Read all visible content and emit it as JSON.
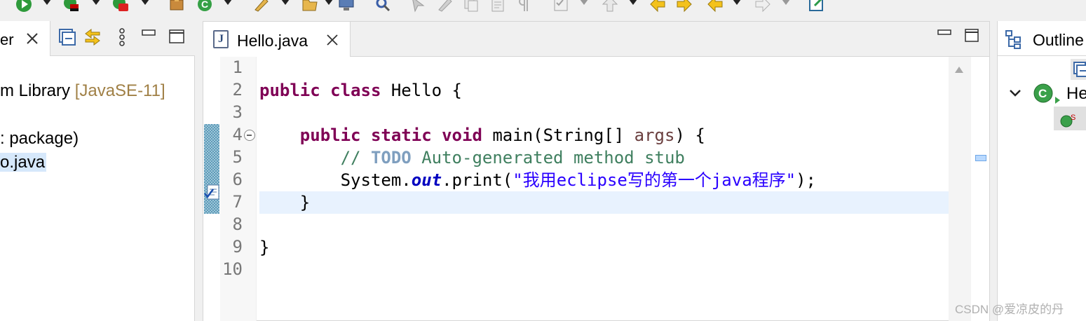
{
  "toolbar": {
    "icons": [
      "debug-icon",
      "run-icon",
      "coverage-icon",
      "external-tools-icon",
      "package-icon",
      "refresh-icon",
      "pen-icon",
      "open-folder-icon",
      "monitor-icon",
      "search-icon",
      "step-icon",
      "edit-icon",
      "copy-icon",
      "paste-icon",
      "paragraph-icon",
      "task-icon",
      "up-icon",
      "back-icon",
      "forward-icon",
      "prev-edit-icon",
      "next-icon",
      "pin-editor-icon"
    ]
  },
  "package_explorer": {
    "tab_label": "er",
    "tree": [
      {
        "text": "m Library ",
        "muted": "[JavaSE-11]"
      },
      {
        "text": ": package)"
      },
      {
        "text": "o.java",
        "selected": true
      }
    ]
  },
  "editor": {
    "tab_label": "Hello.java",
    "tab_icon": "J",
    "line_numbers": [
      "1",
      "2",
      "3",
      "4",
      "5",
      "6",
      "7",
      "8",
      "9",
      "10"
    ],
    "code": {
      "l2_kw1": "public",
      "l2_kw2": "class",
      "l2_rest": " Hello {",
      "l4_kw1": "public",
      "l4_kw2": "static",
      "l4_kw3": "void",
      "l4_mid": " main(String[] ",
      "l4_param": "args",
      "l4_end": ") {",
      "l5_c1": "// ",
      "l5_todo": "TODO",
      "l5_c2": " Auto-generated method stub",
      "l6_a": "System.",
      "l6_field": "out",
      "l6_b": ".print(",
      "l6_string": "\"我用eclipse写的第一个java程序\"",
      "l6_c": ");",
      "l7": "}",
      "l9": "}"
    }
  },
  "outline": {
    "title": "Outline",
    "class_name": "He"
  },
  "watermark": "CSDN @爱凉皮的丹",
  "colors": {
    "keyword": "#7f0055",
    "comment": "#3f7f5f",
    "string": "#2a00ff",
    "current_line": "#e8f2fe",
    "selection": "#d6e8fb"
  }
}
